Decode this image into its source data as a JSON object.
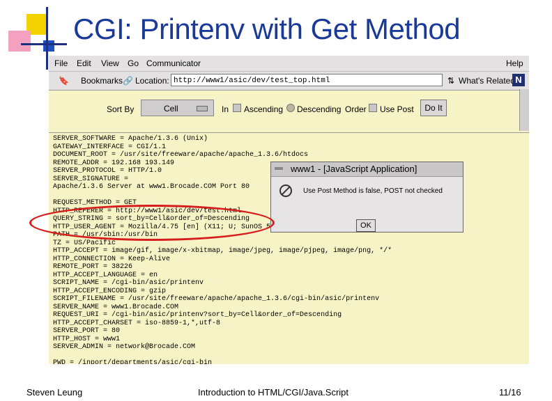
{
  "slide": {
    "title": "CGI: Printenv with Get Method",
    "footer_left": "Steven Leung",
    "footer_center": "Introduction to HTML/CGI/Java.Script",
    "footer_right": "11/16",
    "accent_color": "#f2d200",
    "title_color": "#1a3a9a",
    "highlight_color": "#d61e1e"
  },
  "browser": {
    "menu": [
      "File",
      "Edit",
      "View",
      "Go",
      "Communicator",
      "Help"
    ],
    "toolbar": {
      "bookmarks": "Bookmarks",
      "location_label": "Location:",
      "url": "http://www1/asic/dev/test_top.html",
      "whats_related": "What's Related",
      "logo": "N"
    },
    "form": {
      "sort_by_label": "Sort By",
      "select_value": "Cell",
      "in_label": "In",
      "ascending_label": "Ascending",
      "descending_label": "Descending",
      "order_label": "Order",
      "use_post_label": "Use Post",
      "submit_label": "Do It"
    },
    "env_text": "SERVER_SOFTWARE = Apache/1.3.6 (Unix)\nGATEWAY_INTERFACE = CGI/1.1\nDOCUMENT_ROOT = /usr/site/freeware/apache/apache_1.3.6/htdocs\nREMOTE_ADDR = 192.168 193.149\nSERVER_PROTOCOL = HTTP/1.0\nSERVER_SIGNATURE =\nApache/1.3.6 Server at www1.Brocade.COM Port 80\n\nREQUEST_METHOD = GET\nHTTP_REFERER = http://www1/asic/dev/test.html\nQUERY_STRING = sort_by=Cell&order_of=Descending\nHTTP_USER_AGENT = Mozilla/4.75 [en] (X11; U; SunOS 5.8 sun4u)\nPATH = /usr/sbin:/usr/bin\nTZ = US/Pacific\nHTTP_ACCEPT = image/gif, image/x-xbitmap, image/jpeg, image/pjpeg, image/png, */*\nHTTP_CONNECTION = Keep-Alive\nREMOTE_PORT = 38226\nHTTP_ACCEPT_LANGUAGE = en\nSCRIPT_NAME = /cgi-bin/asic/printenv\nHTTP_ACCEPT_ENCODING = gzip\nSCRIPT_FILENAME = /usr/site/freeware/apache/apache_1.3.6/cgi-bin/asic/printenv\nSERVER_NAME = www1.Brocade.COM\nREQUEST_URI = /cgi-bin/asic/printenv?sort_by=Cell&order_of=Descending\nHTTP_ACCEPT_CHARSET = iso-8859-1,*,utf-8\nSERVER_PORT = 80\nHTTP_HOST = www1\nSERVER_ADMIN = network@Brocade.COM\n\nPWD = /inport/departments/asic/cgi-bin",
    "dialog": {
      "title": "www1 - [JavaScript Application]",
      "message": "Use Post Method is false, POST not checked",
      "ok_label": "OK"
    }
  }
}
